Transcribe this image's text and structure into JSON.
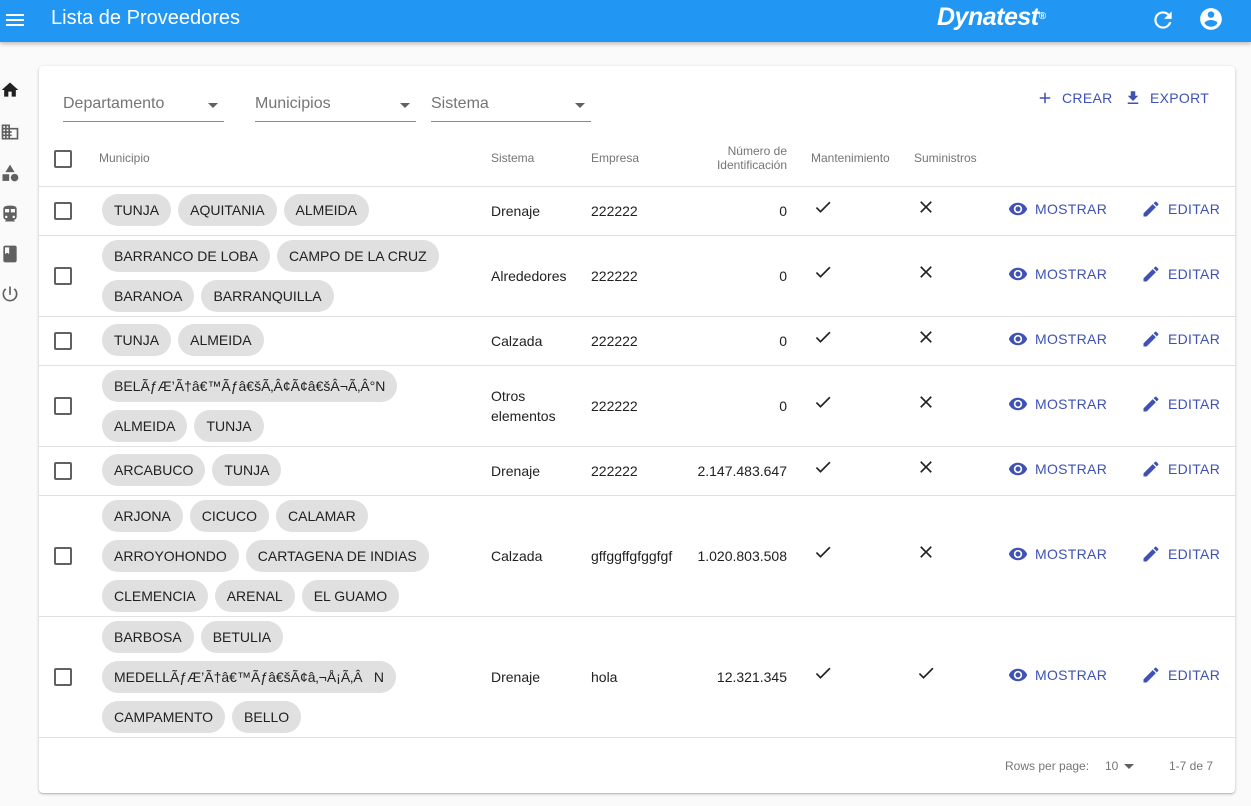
{
  "appbar": {
    "title": "Lista de Proveedores",
    "logo": "Dynatest",
    "logo_mark": "®",
    "color": "#2196f3"
  },
  "sidebar": {
    "icons": [
      "home-icon",
      "building-icon",
      "category-icon",
      "train-icon",
      "book-icon",
      "power-icon"
    ]
  },
  "filters": {
    "departamento": "Departamento",
    "municipios": "Municipios",
    "sistema": "Sistema"
  },
  "toolbar": {
    "crear": "CREAR",
    "export": "EXPORT",
    "accent": "#3f51b5"
  },
  "table": {
    "headers": {
      "municipio": "Municipio",
      "sistema": "Sistema",
      "empresa": "Empresa",
      "numero_line1": "Número de",
      "numero_line2": "Identificación",
      "mantenimiento": "Mantenimiento",
      "suministros": "Suministros"
    },
    "action_show": "MOSTRAR",
    "action_edit": "EDITAR",
    "rows": [
      {
        "municipios": [
          "TUNJA",
          "AQUITANIA",
          "ALMEIDA"
        ],
        "sistema": "Drenaje",
        "empresa": "222222",
        "numero": "0",
        "mantenimiento": true,
        "suministros": false
      },
      {
        "municipios": [
          "BARRANCO DE LOBA",
          "CAMPO DE LA CRUZ",
          "BARANOA",
          "BARRANQUILLA"
        ],
        "sistema": "Alrededores",
        "empresa": "222222",
        "numero": "0",
        "mantenimiento": true,
        "suministros": false
      },
      {
        "municipios": [
          "TUNJA",
          "ALMEIDA"
        ],
        "sistema": "Calzada",
        "empresa": "222222",
        "numero": "0",
        "mantenimiento": true,
        "suministros": false
      },
      {
        "municipios": [
          "BELÃƒÆ’Ã†â€™Ãƒâ€šÃ‚Â¢Ã¢â€šÂ¬Ã‚Â°N",
          "ALMEIDA",
          "TUNJA"
        ],
        "sistema": "Otros elementos",
        "empresa": "222222",
        "numero": "0",
        "mantenimiento": true,
        "suministros": false
      },
      {
        "municipios": [
          "ARCABUCO",
          "TUNJA"
        ],
        "sistema": "Drenaje",
        "empresa": "222222",
        "numero": "2.147.483.647",
        "mantenimiento": true,
        "suministros": false
      },
      {
        "municipios": [
          "ARJONA",
          "CICUCO",
          "CALAMAR",
          "ARROYOHONDO",
          "CARTAGENA DE INDIAS",
          "CLEMENCIA",
          "ARENAL",
          "EL GUAMO"
        ],
        "sistema": "Calzada",
        "empresa": "gffggffgfggfgf",
        "numero": "1.020.803.508",
        "mantenimiento": true,
        "suministros": false
      },
      {
        "municipios": [
          "BARBOSA",
          "BETULIA",
          "MEDELLÃƒÆ’Ã†â€™Ãƒâ€šÃ¢â‚¬Å¡Ã‚ÂN",
          "CAMPAMENTO",
          "BELLO"
        ],
        "sistema": "Drenaje",
        "empresa": "hola",
        "numero": "12.321.345",
        "mantenimiento": true,
        "suministros": true
      }
    ]
  },
  "pagination": {
    "rows_per_page_label": "Rows per page:",
    "rows_per_page_value": "10",
    "range": "1-7 de 7"
  }
}
